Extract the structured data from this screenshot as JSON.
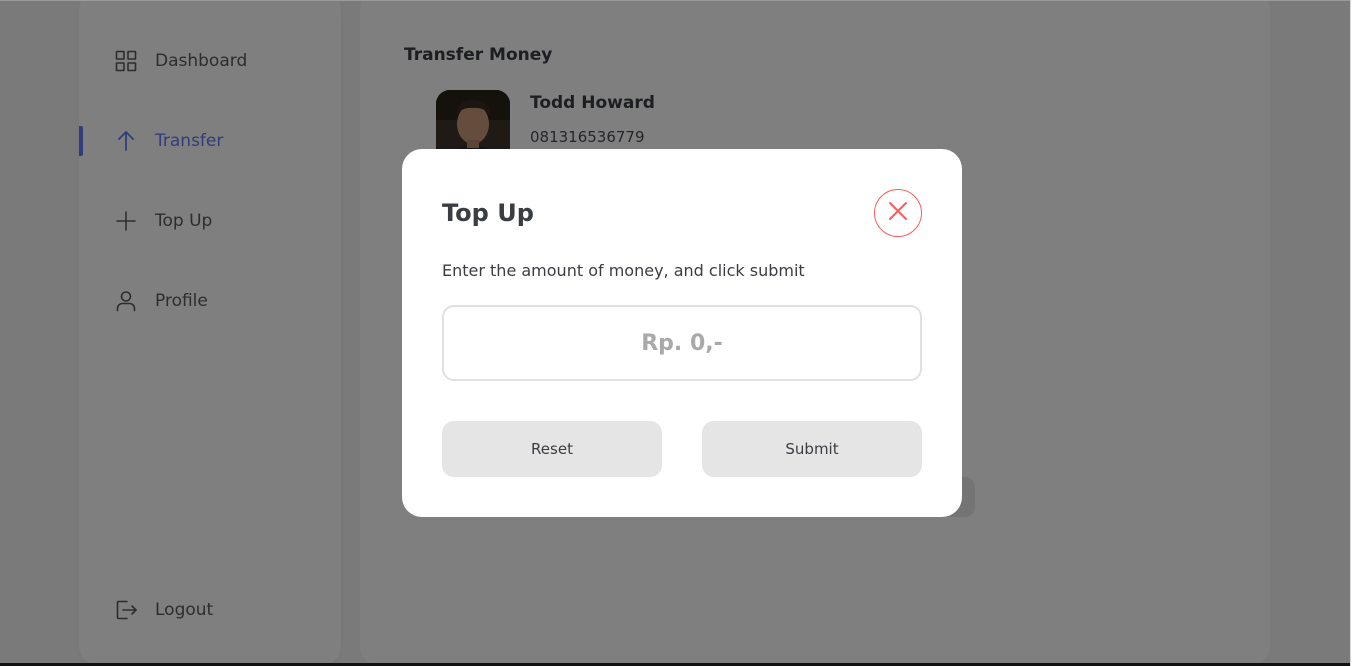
{
  "sidebar": {
    "items": [
      {
        "label": "Dashboard",
        "icon": "grid-icon"
      },
      {
        "label": "Transfer",
        "icon": "arrow-up-icon",
        "active": true
      },
      {
        "label": "Top Up",
        "icon": "plus-icon"
      },
      {
        "label": "Profile",
        "icon": "user-icon"
      }
    ],
    "logout": {
      "label": "Logout",
      "icon": "logout-icon"
    }
  },
  "main": {
    "title": "Transfer Money",
    "contact": {
      "name": "Todd Howard",
      "phone": "081316536779"
    }
  },
  "modal": {
    "title": "Top Up",
    "description": "Enter the amount of money, and click submit",
    "amount_placeholder": "Rp. 0,-",
    "amount_value": "",
    "reset_label": "Reset",
    "submit_label": "Submit"
  },
  "colors": {
    "accent": "#6379f4",
    "close": "#ff5b5b",
    "overlay": "rgba(0,0,0,0.5)"
  }
}
